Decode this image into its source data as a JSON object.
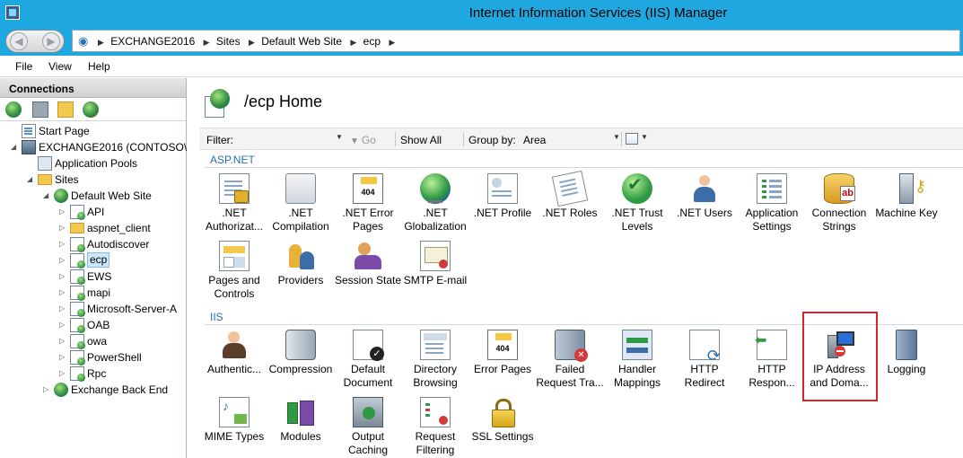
{
  "window": {
    "title": "Internet Information Services (IIS) Manager"
  },
  "address_bar": {
    "crumbs": [
      "EXCHANGE2016",
      "Sites",
      "Default Web Site",
      "ecp"
    ]
  },
  "menu": {
    "file": "File",
    "view": "View",
    "help": "Help"
  },
  "connections": {
    "header": "Connections",
    "tree": [
      {
        "label": "Start Page",
        "icon": "page-icon"
      },
      {
        "label": "EXCHANGE2016 (CONTOSO\\",
        "icon": "server-icon"
      },
      {
        "label": "Application Pools",
        "icon": "app-pool-icon"
      },
      {
        "label": "Sites",
        "icon": "folder-icon"
      },
      {
        "label": "Default Web Site",
        "icon": "globe-icon"
      },
      {
        "label": "API",
        "icon": "site-icon"
      },
      {
        "label": "aspnet_client",
        "icon": "folder-icon"
      },
      {
        "label": "Autodiscover",
        "icon": "site-icon"
      },
      {
        "label": "ecp",
        "icon": "site-icon",
        "selected": true
      },
      {
        "label": "EWS",
        "icon": "site-icon"
      },
      {
        "label": "mapi",
        "icon": "site-icon"
      },
      {
        "label": "Microsoft-Server-A",
        "icon": "site-icon"
      },
      {
        "label": "OAB",
        "icon": "site-icon"
      },
      {
        "label": "owa",
        "icon": "site-icon"
      },
      {
        "label": "PowerShell",
        "icon": "site-icon"
      },
      {
        "label": "Rpc",
        "icon": "site-icon"
      },
      {
        "label": "Exchange Back End",
        "icon": "globe-icon"
      }
    ]
  },
  "main": {
    "title": "/ecp Home",
    "filter": {
      "label": "Filter:",
      "value": "",
      "go": "Go",
      "show_all": "Show All",
      "group_by_label": "Group by:",
      "group_by_value": "Area"
    },
    "sections": [
      {
        "name": "ASP.NET",
        "features": [
          {
            "label": ".NET Authorizat...",
            "icon": "net-authorization-icon"
          },
          {
            "label": ".NET Compilation",
            "icon": "net-compilation-icon"
          },
          {
            "label": ".NET Error Pages",
            "icon": "net-error-pages-icon"
          },
          {
            "label": ".NET Globalization",
            "icon": "net-globalization-icon"
          },
          {
            "label": ".NET Profile",
            "icon": "net-profile-icon"
          },
          {
            "label": ".NET Roles",
            "icon": "net-roles-icon"
          },
          {
            "label": ".NET Trust Levels",
            "icon": "net-trust-levels-icon"
          },
          {
            "label": ".NET Users",
            "icon": "net-users-icon"
          },
          {
            "label": "Application Settings",
            "icon": "application-settings-icon"
          },
          {
            "label": "Connection Strings",
            "icon": "connection-strings-icon"
          },
          {
            "label": "Machine Key",
            "icon": "machine-key-icon"
          },
          {
            "label": "Pages and Controls",
            "icon": "pages-controls-icon"
          },
          {
            "label": "Providers",
            "icon": "providers-icon"
          },
          {
            "label": "Session State",
            "icon": "session-state-icon"
          },
          {
            "label": "SMTP E-mail",
            "icon": "smtp-email-icon"
          }
        ]
      },
      {
        "name": "IIS",
        "features": [
          {
            "label": "Authentic...",
            "icon": "authentication-icon"
          },
          {
            "label": "Compression",
            "icon": "compression-icon"
          },
          {
            "label": "Default Document",
            "icon": "default-document-icon"
          },
          {
            "label": "Directory Browsing",
            "icon": "directory-browsing-icon"
          },
          {
            "label": "Error Pages",
            "icon": "error-pages-icon"
          },
          {
            "label": "Failed Request Tra...",
            "icon": "failed-request-tracing-icon"
          },
          {
            "label": "Handler Mappings",
            "icon": "handler-mappings-icon"
          },
          {
            "label": "HTTP Redirect",
            "icon": "http-redirect-icon"
          },
          {
            "label": "HTTP Respon...",
            "icon": "http-response-headers-icon"
          },
          {
            "label": "IP Address and Doma...",
            "icon": "ip-address-domain-icon",
            "highlighted": true
          },
          {
            "label": "Logging",
            "icon": "logging-icon"
          },
          {
            "label": "MIME Types",
            "icon": "mime-types-icon"
          },
          {
            "label": "Modules",
            "icon": "modules-icon"
          },
          {
            "label": "Output Caching",
            "icon": "output-caching-icon"
          },
          {
            "label": "Request Filtering",
            "icon": "request-filtering-icon"
          },
          {
            "label": "SSL Settings",
            "icon": "ssl-settings-icon"
          }
        ]
      }
    ]
  },
  "colors": {
    "titlebar": "#1fa8e0",
    "section_label": "#2a6fb2",
    "highlight_box": "#e0202a",
    "selection": "#cde8fb"
  }
}
